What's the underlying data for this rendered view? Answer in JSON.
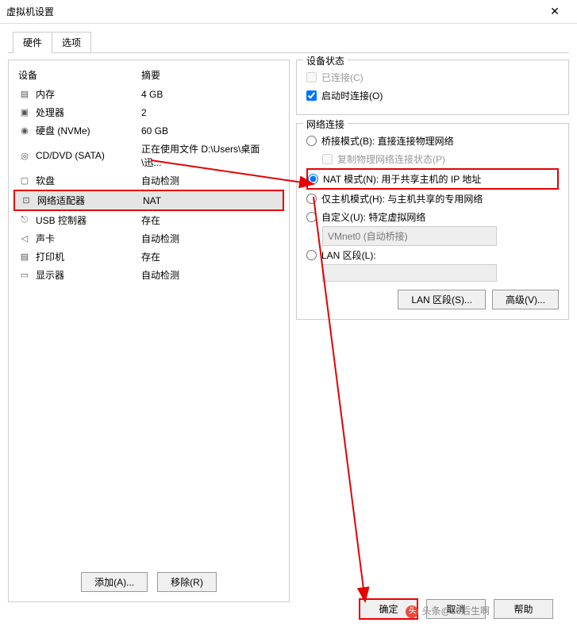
{
  "window": {
    "title": "虚拟机设置"
  },
  "tabs": {
    "hardware": "硬件",
    "options": "选项"
  },
  "dev_list": {
    "header_device": "设备",
    "header_summary": "摘要",
    "items": [
      {
        "name": "内存",
        "summary": "4 GB"
      },
      {
        "name": "处理器",
        "summary": "2"
      },
      {
        "name": "硬盘 (NVMe)",
        "summary": "60 GB"
      },
      {
        "name": "CD/DVD (SATA)",
        "summary": "正在使用文件 D:\\Users\\桌面\\迅..."
      },
      {
        "name": "软盘",
        "summary": "自动检测"
      },
      {
        "name": "网络适配器",
        "summary": "NAT"
      },
      {
        "name": "USB 控制器",
        "summary": "存在"
      },
      {
        "name": "声卡",
        "summary": "自动检测"
      },
      {
        "name": "打印机",
        "summary": "存在"
      },
      {
        "name": "显示器",
        "summary": "自动检测"
      }
    ]
  },
  "left_buttons": {
    "add": "添加(A)...",
    "remove": "移除(R)"
  },
  "status": {
    "legend": "设备状态",
    "connected": "已连接(C)",
    "connect_at_power": "启动时连接(O)"
  },
  "network": {
    "legend": "网络连接",
    "bridge": "桥接模式(B): 直接连接物理网络",
    "replicate": "复制物理网络连接状态(P)",
    "nat": "NAT 模式(N): 用于共享主机的 IP 地址",
    "hostonly": "仅主机模式(H): 与主机共享的专用网络",
    "custom": "自定义(U): 特定虚拟网络",
    "custom_value": "VMnet0 (自动桥接)",
    "lanseg": "LAN 区段(L):",
    "lanseg_btn": "LAN 区段(S)...",
    "advanced_btn": "高级(V)..."
  },
  "bottom": {
    "ok": "确定",
    "cancel": "取消",
    "help": "帮助"
  },
  "watermark": "头条@80后生啊"
}
